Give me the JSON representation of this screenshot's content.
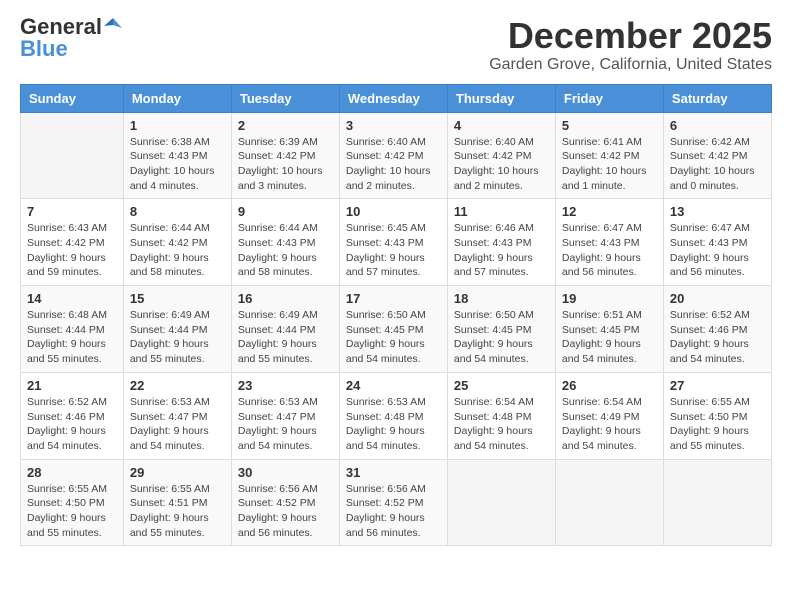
{
  "logo": {
    "general": "General",
    "blue": "Blue"
  },
  "title": "December 2025",
  "subtitle": "Garden Grove, California, United States",
  "headers": [
    "Sunday",
    "Monday",
    "Tuesday",
    "Wednesday",
    "Thursday",
    "Friday",
    "Saturday"
  ],
  "weeks": [
    [
      {
        "day": "",
        "info": ""
      },
      {
        "day": "1",
        "info": "Sunrise: 6:38 AM\nSunset: 4:43 PM\nDaylight: 10 hours\nand 4 minutes."
      },
      {
        "day": "2",
        "info": "Sunrise: 6:39 AM\nSunset: 4:42 PM\nDaylight: 10 hours\nand 3 minutes."
      },
      {
        "day": "3",
        "info": "Sunrise: 6:40 AM\nSunset: 4:42 PM\nDaylight: 10 hours\nand 2 minutes."
      },
      {
        "day": "4",
        "info": "Sunrise: 6:40 AM\nSunset: 4:42 PM\nDaylight: 10 hours\nand 2 minutes."
      },
      {
        "day": "5",
        "info": "Sunrise: 6:41 AM\nSunset: 4:42 PM\nDaylight: 10 hours\nand 1 minute."
      },
      {
        "day": "6",
        "info": "Sunrise: 6:42 AM\nSunset: 4:42 PM\nDaylight: 10 hours\nand 0 minutes."
      }
    ],
    [
      {
        "day": "7",
        "info": "Sunrise: 6:43 AM\nSunset: 4:42 PM\nDaylight: 9 hours\nand 59 minutes."
      },
      {
        "day": "8",
        "info": "Sunrise: 6:44 AM\nSunset: 4:42 PM\nDaylight: 9 hours\nand 58 minutes."
      },
      {
        "day": "9",
        "info": "Sunrise: 6:44 AM\nSunset: 4:43 PM\nDaylight: 9 hours\nand 58 minutes."
      },
      {
        "day": "10",
        "info": "Sunrise: 6:45 AM\nSunset: 4:43 PM\nDaylight: 9 hours\nand 57 minutes."
      },
      {
        "day": "11",
        "info": "Sunrise: 6:46 AM\nSunset: 4:43 PM\nDaylight: 9 hours\nand 57 minutes."
      },
      {
        "day": "12",
        "info": "Sunrise: 6:47 AM\nSunset: 4:43 PM\nDaylight: 9 hours\nand 56 minutes."
      },
      {
        "day": "13",
        "info": "Sunrise: 6:47 AM\nSunset: 4:43 PM\nDaylight: 9 hours\nand 56 minutes."
      }
    ],
    [
      {
        "day": "14",
        "info": "Sunrise: 6:48 AM\nSunset: 4:44 PM\nDaylight: 9 hours\nand 55 minutes."
      },
      {
        "day": "15",
        "info": "Sunrise: 6:49 AM\nSunset: 4:44 PM\nDaylight: 9 hours\nand 55 minutes."
      },
      {
        "day": "16",
        "info": "Sunrise: 6:49 AM\nSunset: 4:44 PM\nDaylight: 9 hours\nand 55 minutes."
      },
      {
        "day": "17",
        "info": "Sunrise: 6:50 AM\nSunset: 4:45 PM\nDaylight: 9 hours\nand 54 minutes."
      },
      {
        "day": "18",
        "info": "Sunrise: 6:50 AM\nSunset: 4:45 PM\nDaylight: 9 hours\nand 54 minutes."
      },
      {
        "day": "19",
        "info": "Sunrise: 6:51 AM\nSunset: 4:45 PM\nDaylight: 9 hours\nand 54 minutes."
      },
      {
        "day": "20",
        "info": "Sunrise: 6:52 AM\nSunset: 4:46 PM\nDaylight: 9 hours\nand 54 minutes."
      }
    ],
    [
      {
        "day": "21",
        "info": "Sunrise: 6:52 AM\nSunset: 4:46 PM\nDaylight: 9 hours\nand 54 minutes."
      },
      {
        "day": "22",
        "info": "Sunrise: 6:53 AM\nSunset: 4:47 PM\nDaylight: 9 hours\nand 54 minutes."
      },
      {
        "day": "23",
        "info": "Sunrise: 6:53 AM\nSunset: 4:47 PM\nDaylight: 9 hours\nand 54 minutes."
      },
      {
        "day": "24",
        "info": "Sunrise: 6:53 AM\nSunset: 4:48 PM\nDaylight: 9 hours\nand 54 minutes."
      },
      {
        "day": "25",
        "info": "Sunrise: 6:54 AM\nSunset: 4:48 PM\nDaylight: 9 hours\nand 54 minutes."
      },
      {
        "day": "26",
        "info": "Sunrise: 6:54 AM\nSunset: 4:49 PM\nDaylight: 9 hours\nand 54 minutes."
      },
      {
        "day": "27",
        "info": "Sunrise: 6:55 AM\nSunset: 4:50 PM\nDaylight: 9 hours\nand 55 minutes."
      }
    ],
    [
      {
        "day": "28",
        "info": "Sunrise: 6:55 AM\nSunset: 4:50 PM\nDaylight: 9 hours\nand 55 minutes."
      },
      {
        "day": "29",
        "info": "Sunrise: 6:55 AM\nSunset: 4:51 PM\nDaylight: 9 hours\nand 55 minutes."
      },
      {
        "day": "30",
        "info": "Sunrise: 6:56 AM\nSunset: 4:52 PM\nDaylight: 9 hours\nand 56 minutes."
      },
      {
        "day": "31",
        "info": "Sunrise: 6:56 AM\nSunset: 4:52 PM\nDaylight: 9 hours\nand 56 minutes."
      },
      {
        "day": "",
        "info": ""
      },
      {
        "day": "",
        "info": ""
      },
      {
        "day": "",
        "info": ""
      }
    ]
  ]
}
